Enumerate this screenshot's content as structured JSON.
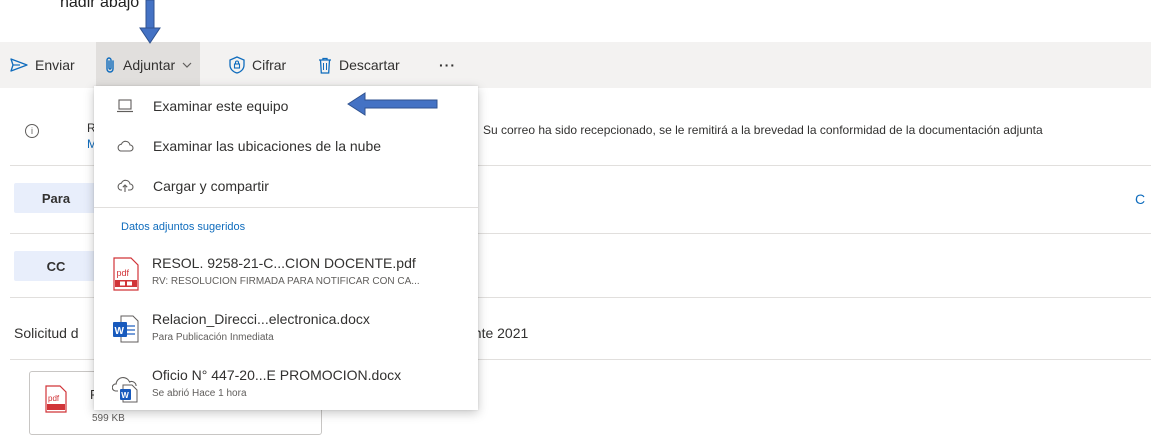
{
  "caption": {
    "text": "ñadir abajo"
  },
  "toolbar": {
    "send_label": "Enviar",
    "attach_label": "Adjuntar",
    "encrypt_label": "Cifrar",
    "discard_label": "Descartar",
    "more_label": "···"
  },
  "background": {
    "info_peek_r": "R",
    "info_peek_m": "M",
    "info_message": "Su correo ha sido recepcionado, se le remitirá a la brevedad la conformidad de la documentación adjunta",
    "to_label": "Para",
    "cc_label": "CC",
    "cc_right_peek": "C",
    "subject_peek": "Solicitud d",
    "subject_rest": "ente 2021",
    "attachment_peek": "F",
    "attachment_size": "599 KB"
  },
  "menu": {
    "items": [
      {
        "label": "Examinar este equipo",
        "icon": "laptop-icon"
      },
      {
        "label": "Examinar las ubicaciones de la nube",
        "icon": "cloud-icon"
      },
      {
        "label": "Cargar y compartir",
        "icon": "cloud-upload-icon"
      }
    ],
    "suggested_heading": "Datos adjuntos sugeridos",
    "suggested_files": [
      {
        "name": "RESOL. 9258-21-C...CION DOCENTE.pdf",
        "subtitle": "RV: RESOLUCION FIRMADA PARA NOTIFICAR CON CA...",
        "icon": "pdf-file-icon"
      },
      {
        "name": "Relacion_Direcci...electronica.docx",
        "subtitle": "Para Publicación Inmediata",
        "icon": "word-file-icon"
      },
      {
        "name": "Oficio N° 447-20...E PROMOCION.docx",
        "subtitle": "Se abrió Hace 1 hora",
        "icon": "cloud-word-file-icon"
      }
    ]
  },
  "colors": {
    "accent": "#0f6cbd",
    "annotation_arrow": "#4472c4",
    "pdf_red": "#d13438",
    "word_blue": "#185abd"
  }
}
